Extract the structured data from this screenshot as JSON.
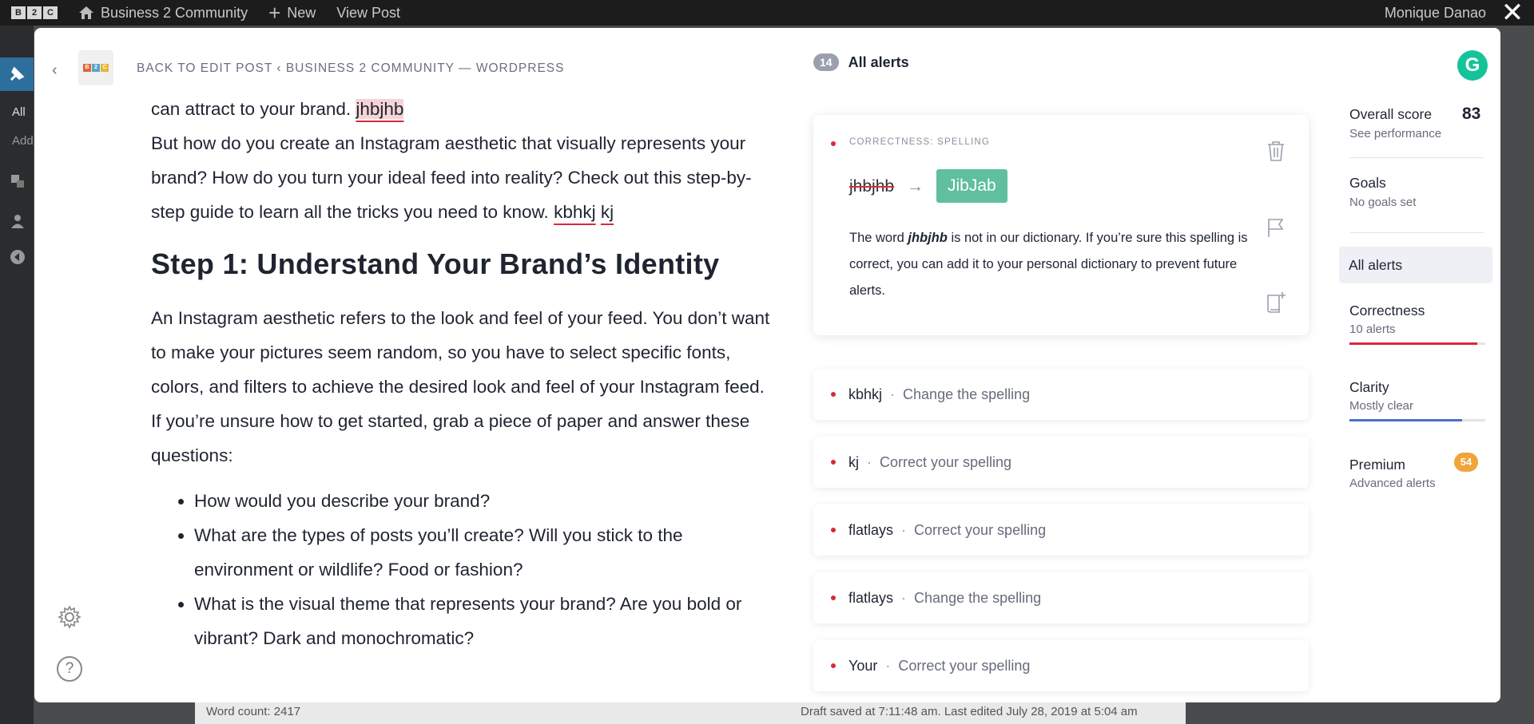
{
  "adminbar": {
    "logo_letters": [
      "B",
      "2",
      "C"
    ],
    "site_name": "Business 2 Community",
    "new_label": "New",
    "view_post_label": "View Post",
    "user_name": "Monique Danao",
    "close_glyph": "✕"
  },
  "wp_sidebar": {
    "all_label": "All",
    "add_label": "Add"
  },
  "status": {
    "word_count": "Word count: 2417",
    "saved": "Draft saved at 7:11:48 am. Last edited July 28, 2019 at 5:04 am"
  },
  "editor": {
    "back_glyph": "‹",
    "site_logo_letters": [
      "B",
      "2",
      "C"
    ],
    "breadcrumb": "BACK TO EDIT POST ‹ BUSINESS 2 COMMUNITY — WORDPRESS",
    "p1_text": "can attract to your brand. ",
    "p1_err": "jhbjhb",
    "p2_text": "But how do you create an Instagram aesthetic that visually represents your brand? How do you turn your ideal feed into reality? Check out this step-by-step guide to learn all the tricks you need to know. ",
    "p2_err1": "kbhkj",
    "p2_err2": "kj",
    "heading": "Step 1: Understand Your Brand’s Identity",
    "p3": "An Instagram aesthetic refers to the look and feel of your feed. You don’t want to make your pictures seem random, so you have to select specific fonts, colors, and filters to achieve the desired look and feel of your Instagram feed. If you’re unsure how to get started, grab a piece of paper and answer these questions:",
    "bullets": [
      "How would you describe your brand?",
      "What are the types of posts you’ll create? Will you stick to the environment or wildlife? Food or fashion?",
      "What is the visual theme that represents your brand? Are you bold or vibrant? Dark and monochromatic?"
    ],
    "help_glyph": "?"
  },
  "alerts": {
    "count": "14",
    "title": "All alerts",
    "card": {
      "category": "CORRECTNESS: SPELLING",
      "original": "jhbjhb",
      "arrow": "→",
      "suggestion": "JibJab",
      "desc_pre": "The word ",
      "desc_word": "jhbjhb",
      "desc_post": " is not in our dictionary. If you’re sure this spelling is correct, you can add it to your personal dictionary to prevent future alerts."
    },
    "rows": [
      {
        "word": "kbhkj",
        "sep": "·",
        "hint": "Change the spelling"
      },
      {
        "word": "kj",
        "sep": "·",
        "hint": "Correct your spelling"
      },
      {
        "word": "flatlays",
        "sep": "·",
        "hint": "Correct your spelling"
      },
      {
        "word": "flatlays",
        "sep": "·",
        "hint": "Change the spelling"
      },
      {
        "word": "Your",
        "sep": "·",
        "hint": "Correct your spelling"
      }
    ]
  },
  "sidebar": {
    "logo": "G",
    "score_label": "Overall score",
    "score_value": "83",
    "score_sub": "See performance",
    "goals_label": "Goals",
    "goals_sub": "No goals set",
    "all_alerts": "All alerts",
    "correctness": {
      "label": "Correctness",
      "sub": "10 alerts",
      "level": 0.94,
      "color": "#d82a3a"
    },
    "clarity": {
      "label": "Clarity",
      "sub": "Mostly clear",
      "level": 0.83,
      "color": "#4a6fcf"
    },
    "premium": {
      "label": "Premium",
      "sub": "Advanced alerts",
      "badge": "54",
      "color": "#f0a43a"
    }
  },
  "colors": {
    "grammarly_green": "#15c39a",
    "error_red": "#d82a3a",
    "suggestion_green": "#5fbf9e"
  }
}
